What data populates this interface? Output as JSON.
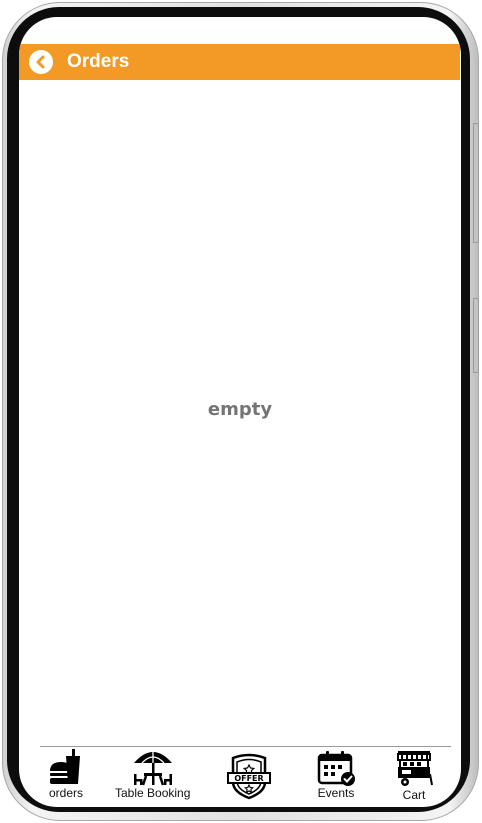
{
  "header": {
    "title": "Orders",
    "background_color": "#f39a26",
    "back_icon": "chevron-left-circle-icon"
  },
  "main": {
    "empty_message": "empty"
  },
  "bottom_nav": {
    "items": [
      {
        "label": "orders",
        "icon": "burger-drink-icon"
      },
      {
        "label": "Table Booking",
        "icon": "umbrella-table-icon"
      },
      {
        "label": "",
        "icon": "offer-badge-icon",
        "badge_text": "OFFER"
      },
      {
        "label": "Events",
        "icon": "calendar-check-icon"
      },
      {
        "label": "Cart",
        "icon": "food-cart-icon"
      }
    ]
  }
}
